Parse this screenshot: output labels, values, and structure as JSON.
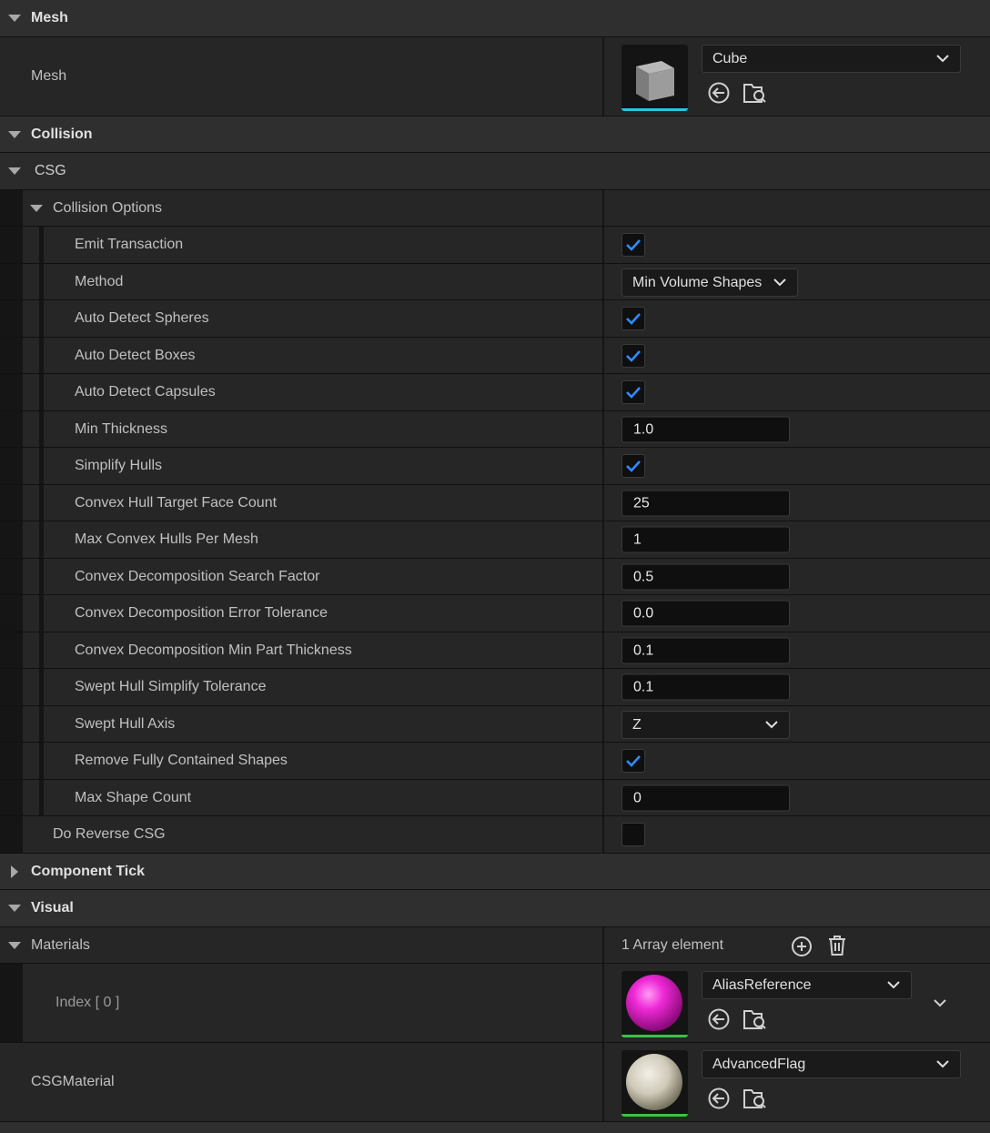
{
  "mesh_section": {
    "title": "Mesh",
    "label": "Mesh",
    "asset_name": "Cube",
    "asset_bar_color": "#22c8d8"
  },
  "collision_section": {
    "title": "Collision"
  },
  "csg_section": {
    "title": "CSG"
  },
  "collision_options": {
    "title": "Collision Options",
    "emit_transaction": {
      "label": "Emit Transaction",
      "checked": true
    },
    "method": {
      "label": "Method",
      "value": "Min Volume Shapes"
    },
    "auto_detect_spheres": {
      "label": "Auto Detect Spheres",
      "checked": true
    },
    "auto_detect_boxes": {
      "label": "Auto Detect Boxes",
      "checked": true
    },
    "auto_detect_capsules": {
      "label": "Auto Detect Capsules",
      "checked": true
    },
    "min_thickness": {
      "label": "Min Thickness",
      "value": "1.0"
    },
    "simplify_hulls": {
      "label": "Simplify Hulls",
      "checked": true
    },
    "convex_hull_target_face_count": {
      "label": "Convex Hull Target Face Count",
      "value": "25"
    },
    "max_convex_hulls_per_mesh": {
      "label": "Max Convex Hulls Per Mesh",
      "value": "1"
    },
    "convex_decomposition_search_factor": {
      "label": "Convex Decomposition Search Factor",
      "value": "0.5"
    },
    "convex_decomposition_error_tolerance": {
      "label": "Convex Decomposition Error Tolerance",
      "value": "0.0"
    },
    "convex_decomposition_min_part_thickness": {
      "label": "Convex Decomposition Min Part Thickness",
      "value": "0.1"
    },
    "swept_hull_simplify_tolerance": {
      "label": "Swept Hull Simplify Tolerance",
      "value": "0.1"
    },
    "swept_hull_axis": {
      "label": "Swept Hull Axis",
      "value": "Z"
    },
    "remove_fully_contained_shapes": {
      "label": "Remove Fully Contained Shapes",
      "checked": true
    },
    "max_shape_count": {
      "label": "Max Shape Count",
      "value": "0"
    }
  },
  "do_reverse_csg": {
    "label": "Do Reverse CSG",
    "checked": false
  },
  "component_tick_section": {
    "title": "Component Tick"
  },
  "visual_section": {
    "title": "Visual"
  },
  "materials": {
    "label": "Materials",
    "count_text": "1 Array element",
    "index_label": "Index [ 0 ]",
    "index0_value": "AliasReference",
    "index0_bar_color": "#3cc048"
  },
  "csg_material": {
    "label": "CSGMaterial",
    "value": "AdvancedFlag",
    "bar_color": "#3cc048"
  },
  "colors": {
    "accent_check": "#2f8bff",
    "panel_bg": "#262626",
    "category_bg": "#2f2f2f"
  }
}
